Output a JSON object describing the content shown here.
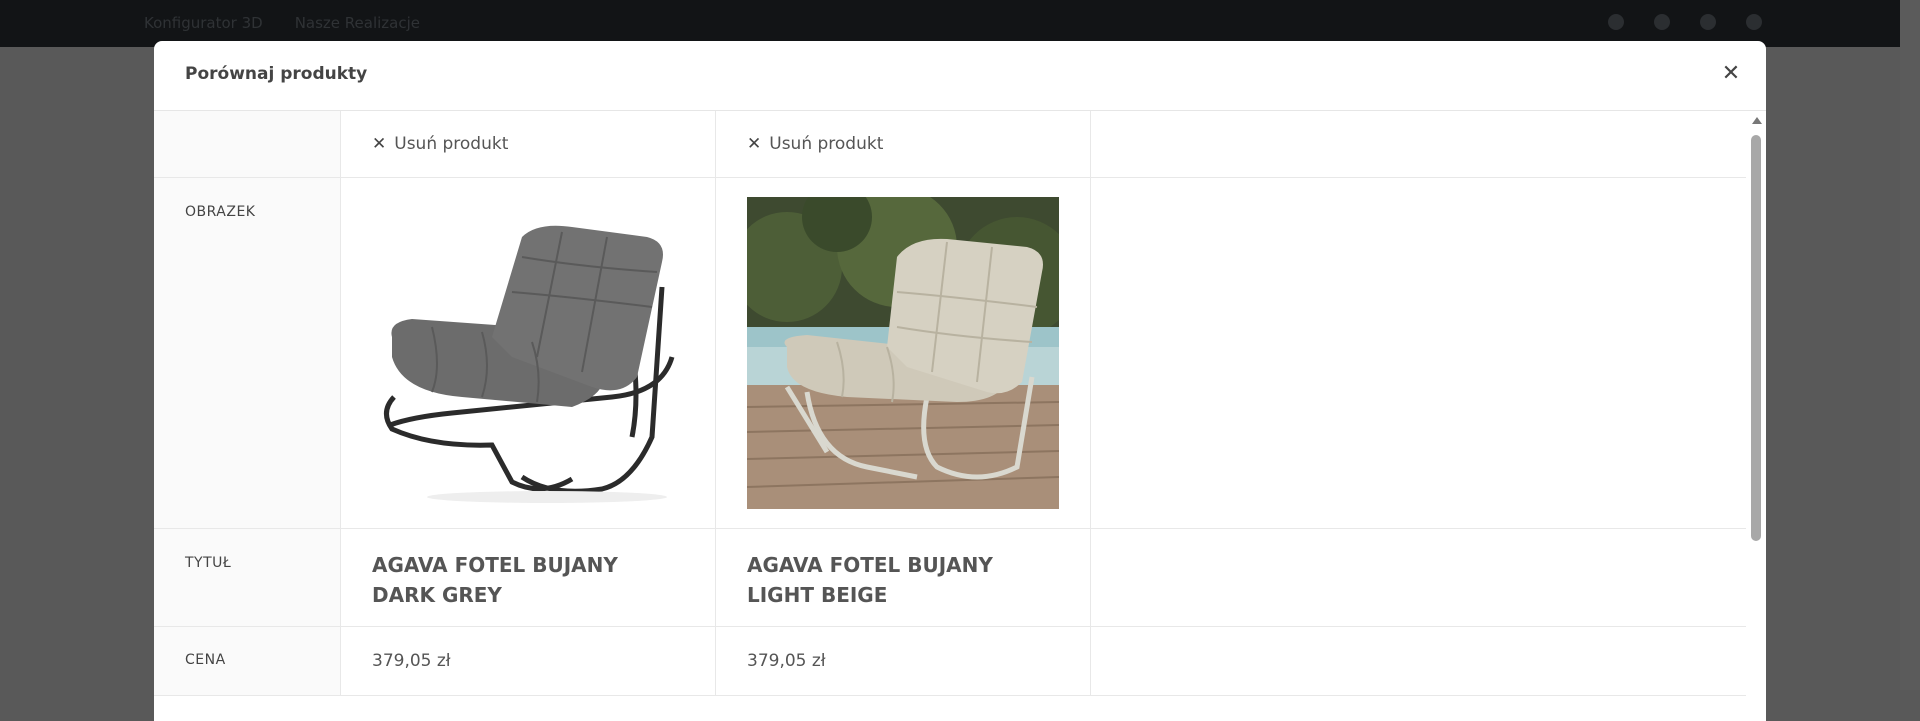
{
  "topbar": {
    "nav": [
      "Konfigurator 3D",
      "Nasze Realizacje"
    ],
    "social_icons": [
      "facebook-icon",
      "instagram-icon",
      "tiktok-icon",
      "whatsapp-icon"
    ]
  },
  "modal": {
    "title": "Porównaj produkty",
    "close_icon": "close-icon",
    "remove_label": "Usuń produkt",
    "rows": {
      "image": "OBRAZEK",
      "title": "TYTUŁ",
      "price": "CENA"
    },
    "products": [
      {
        "title": "AGAVA FOTEL BUJANY DARK GREY",
        "price": "379,05 zł",
        "image_alt": "rocking-chair-dark-grey"
      },
      {
        "title": "AGAVA FOTEL BUJANY LIGHT BEIGE",
        "price": "379,05 zł",
        "image_alt": "rocking-chair-light-beige"
      }
    ]
  }
}
